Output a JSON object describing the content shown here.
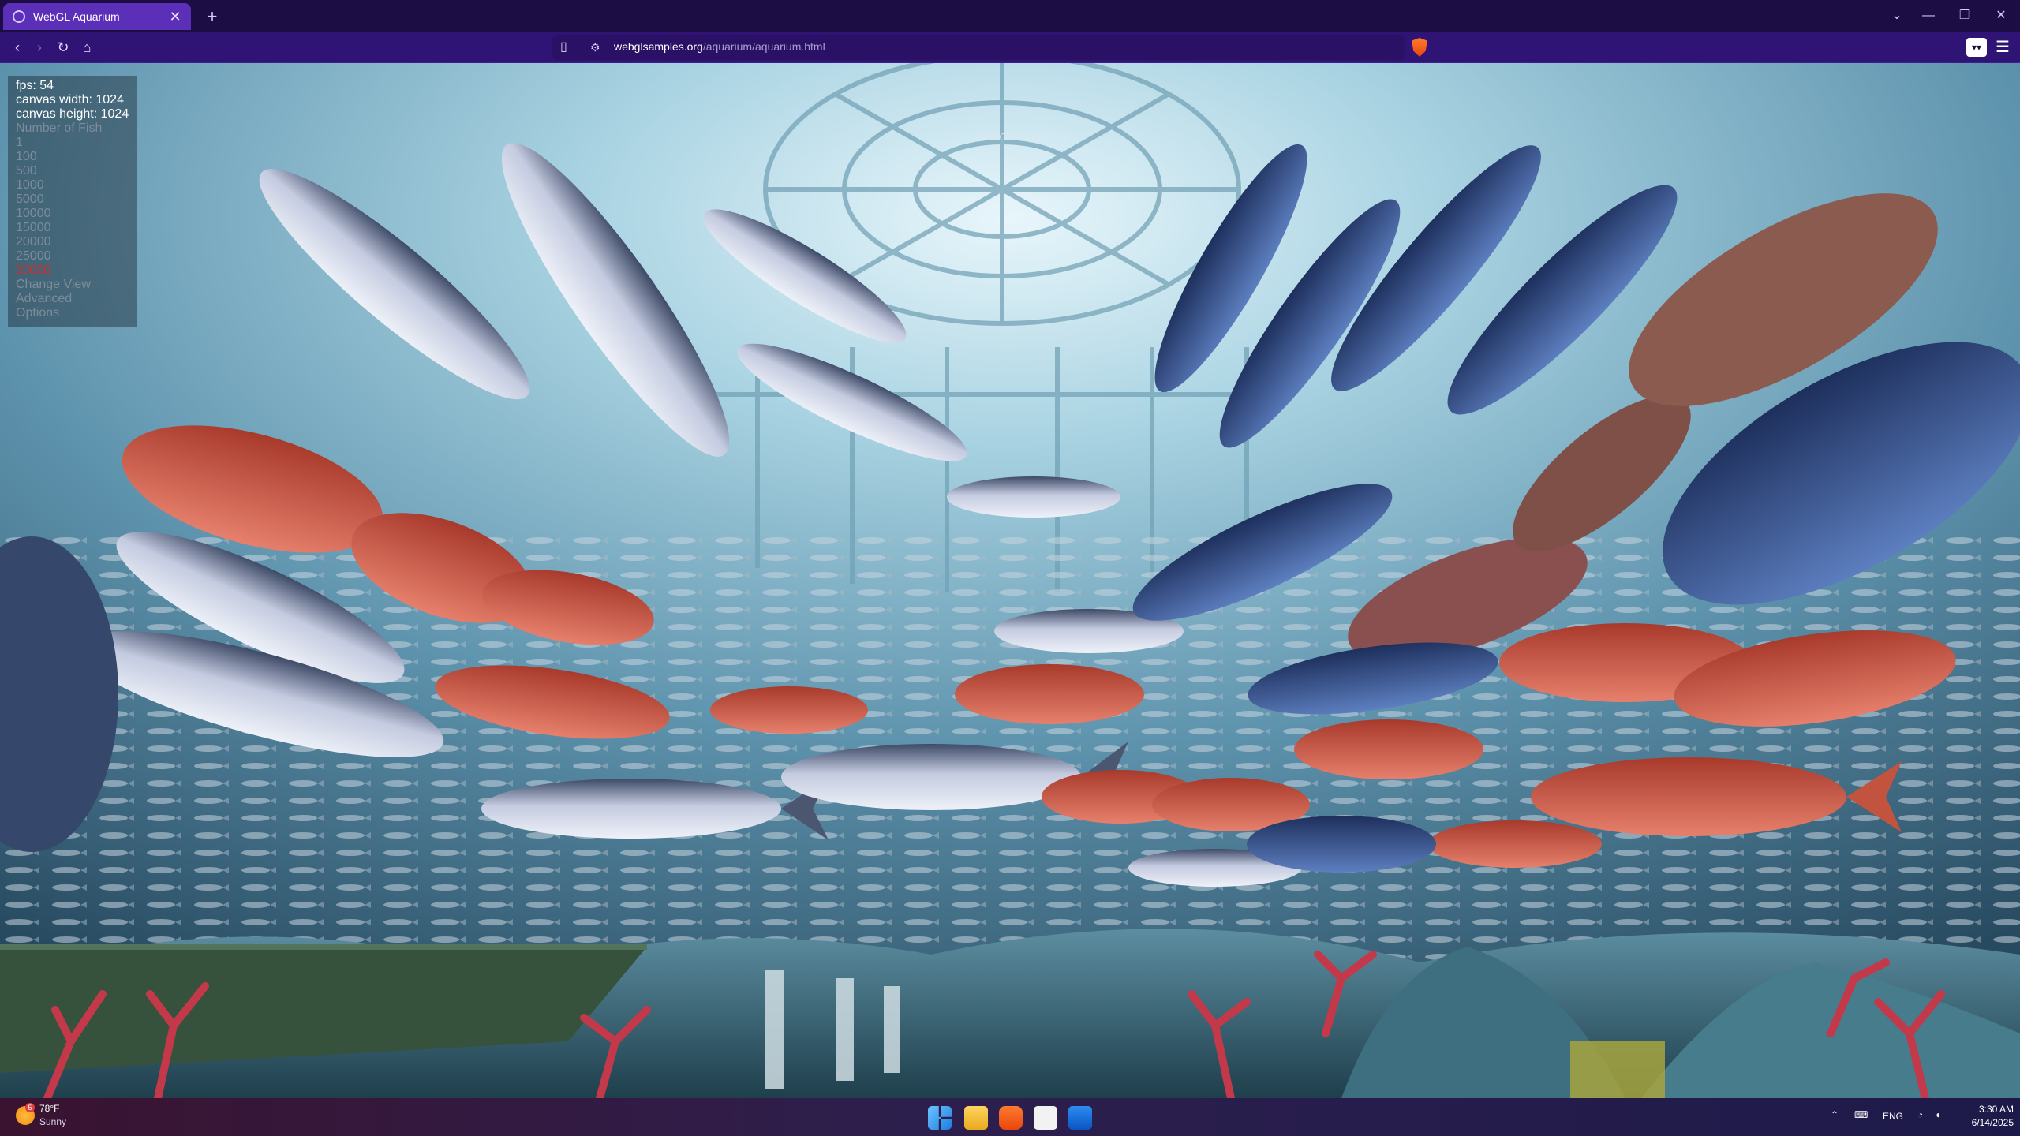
{
  "browser": {
    "tab_title": "WebGL Aquarium",
    "tab_close": "✕",
    "new_tab": "+",
    "url_host": "webglsamples.org",
    "url_path": "/aquarium/aquarium.html",
    "window_controls": {
      "tabs": "⌄",
      "minimize": "—",
      "restore": "❐",
      "close": "✕"
    },
    "nav": {
      "back": "‹",
      "forward": "›",
      "reload": "↻",
      "home": "⌂"
    },
    "menu": "☰"
  },
  "aquarium": {
    "scene_title": "WebGL Aquarium",
    "fps_label": "fps: 54",
    "canvas_width_label": "canvas width: 1024",
    "canvas_height_label": "canvas height: 1024",
    "fish_heading": "Number of Fish",
    "fish_options": [
      "1",
      "100",
      "500",
      "1000",
      "5000",
      "10000",
      "15000",
      "20000",
      "25000",
      "30000"
    ],
    "selected_fish": "30000",
    "links": [
      "Change View",
      "Advanced",
      "Options"
    ]
  },
  "taskbar": {
    "weather_temp": "78°F",
    "weather_desc": "Sunny",
    "weather_badge": "5",
    "language": "ENG",
    "time": "3:30 AM",
    "date": "6/14/2025"
  },
  "colors": {
    "tab_active": "#5b2fb8",
    "toolbar": "#2f1475",
    "selected_option": "#d12d2d",
    "water_top": "#cfe6ee",
    "water_deep": "#2d5a74"
  }
}
